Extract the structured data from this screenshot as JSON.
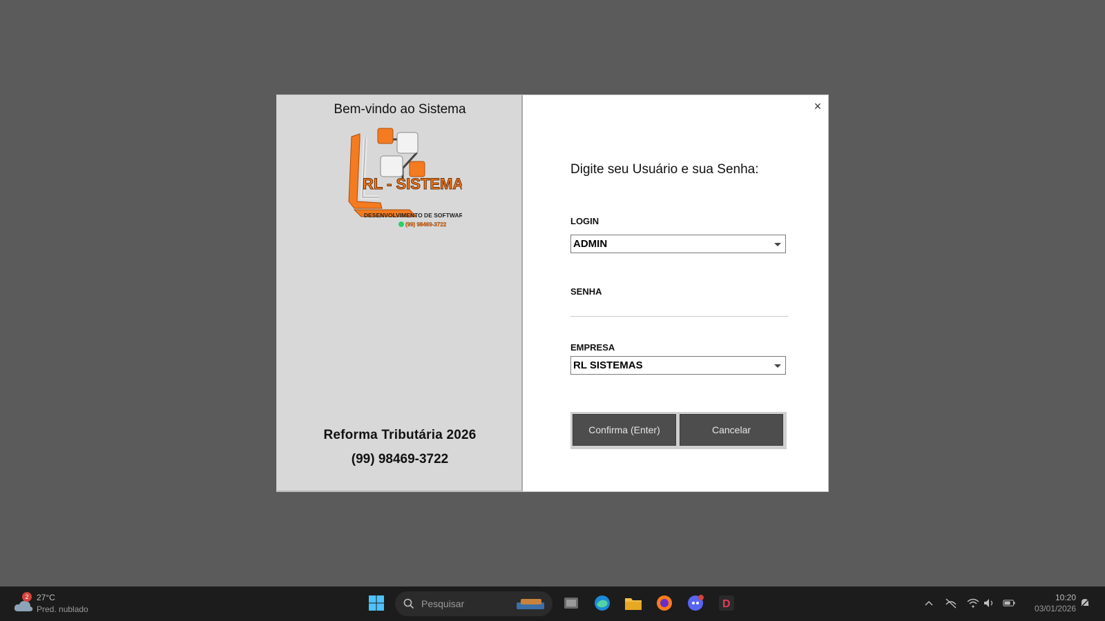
{
  "dialog": {
    "welcome": "Bem-vindo ao Sistema",
    "logo": {
      "brand": "RL - SISTEMAS",
      "tagline": "DESENVOLVIMENTO DE SOFTWARES",
      "phone": "(99) 98469-3722"
    },
    "footer_title": "Reforma Tributária 2026",
    "footer_phone": "(99) 98469-3722",
    "close_glyph": "×",
    "prompt": "Digite seu Usuário e sua Senha:",
    "login_label": "LOGIN",
    "login_value": "ADMIN",
    "senha_label": "SENHA",
    "senha_value": "",
    "empresa_label": "EMPRESA",
    "empresa_value": "RL SISTEMAS",
    "confirm_label": "Confirma (Enter)",
    "cancel_label": "Cancelar",
    "colors": {
      "brand_orange": "#f47b20",
      "button_gray": "#4d4d4d",
      "overlay": "#5b5b5b"
    }
  },
  "taskbar": {
    "weather_badge": "2",
    "weather_temp": "27°C",
    "weather_cond": "Pred. nublado",
    "search_placeholder": "Pesquisar",
    "apps": [
      "windows-start-icon",
      "task-view-icon",
      "edge-icon",
      "file-explorer-icon",
      "firefox-icon",
      "discord-icon",
      "d-app-icon"
    ],
    "tray": [
      "chevron-up-icon",
      "network-off-icon",
      "wifi-icon",
      "volume-icon",
      "battery-icon",
      "notification-icon"
    ],
    "time": "10:20",
    "date": "03/01/2026"
  }
}
